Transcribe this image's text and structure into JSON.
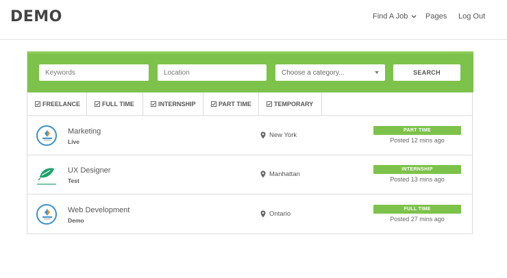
{
  "header": {
    "logo": "DEMO",
    "nav": [
      {
        "label": "Find A Job"
      },
      {
        "label": "Pages"
      },
      {
        "label": "Log Out"
      }
    ]
  },
  "search": {
    "keywords_placeholder": "Keywords",
    "location_placeholder": "Location",
    "category_selected": "Choose a category...",
    "button_label": "SEARCH"
  },
  "filters": [
    {
      "label": "FREELANCE",
      "checked": true
    },
    {
      "label": "FULL TIME",
      "checked": true
    },
    {
      "label": "INTERNSHIP",
      "checked": true
    },
    {
      "label": "PART TIME",
      "checked": true
    },
    {
      "label": "TEMPORARY",
      "checked": true
    }
  ],
  "jobs": [
    {
      "title": "Marketing",
      "company": "Live",
      "location": "New York",
      "type": "PART TIME",
      "posted": "Posted 12 mins ago",
      "logo_icon": "company-logo-circle-icon"
    },
    {
      "title": "UX Designer",
      "company": "Test",
      "location": "Manhattan",
      "type": "INTERNSHIP",
      "posted": "Posted 13 mins ago",
      "logo_icon": "company-logo-leaf-icon"
    },
    {
      "title": "Web Development",
      "company": "Demo",
      "location": "Ontario",
      "type": "FULL TIME",
      "posted": "Posted 27 mins ago",
      "logo_icon": "company-logo-circle-icon"
    }
  ],
  "colors": {
    "accent_green": "#7dc24a",
    "logo_blue": "#3a8fc8",
    "logo_orange": "#f08a24"
  }
}
